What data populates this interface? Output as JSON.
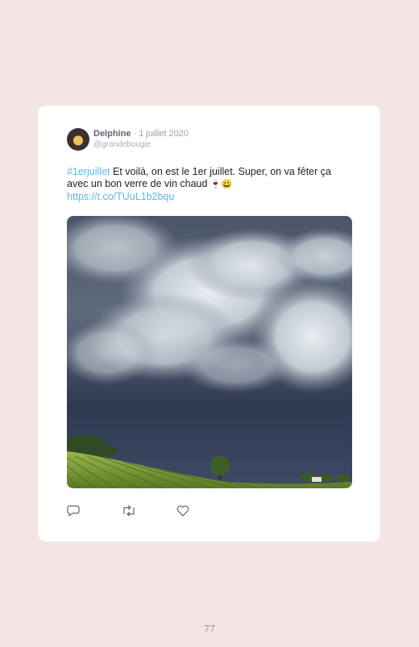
{
  "tweet": {
    "author_name": "Delphine",
    "separator": " · ",
    "date": "1 juillet 2020",
    "handle": "@grandebougie",
    "hashtag": "#1erjuillet",
    "text_line1": " Et voilà, on est le 1er juillet. Super, on va fêter ça",
    "text_line2": "avec un bon verre de vin chaud ",
    "emojis": "🍷😀",
    "link": "https://t.co/TUuL1b2bqu",
    "photo_alt": "stormy sky over a vineyard",
    "actions": [
      "reply-icon",
      "retweet-icon",
      "like-icon"
    ]
  },
  "page": {
    "number": "77"
  },
  "colors": {
    "background": "#f4e4e4",
    "card": "#ffffff",
    "link": "#5bb6e8"
  }
}
